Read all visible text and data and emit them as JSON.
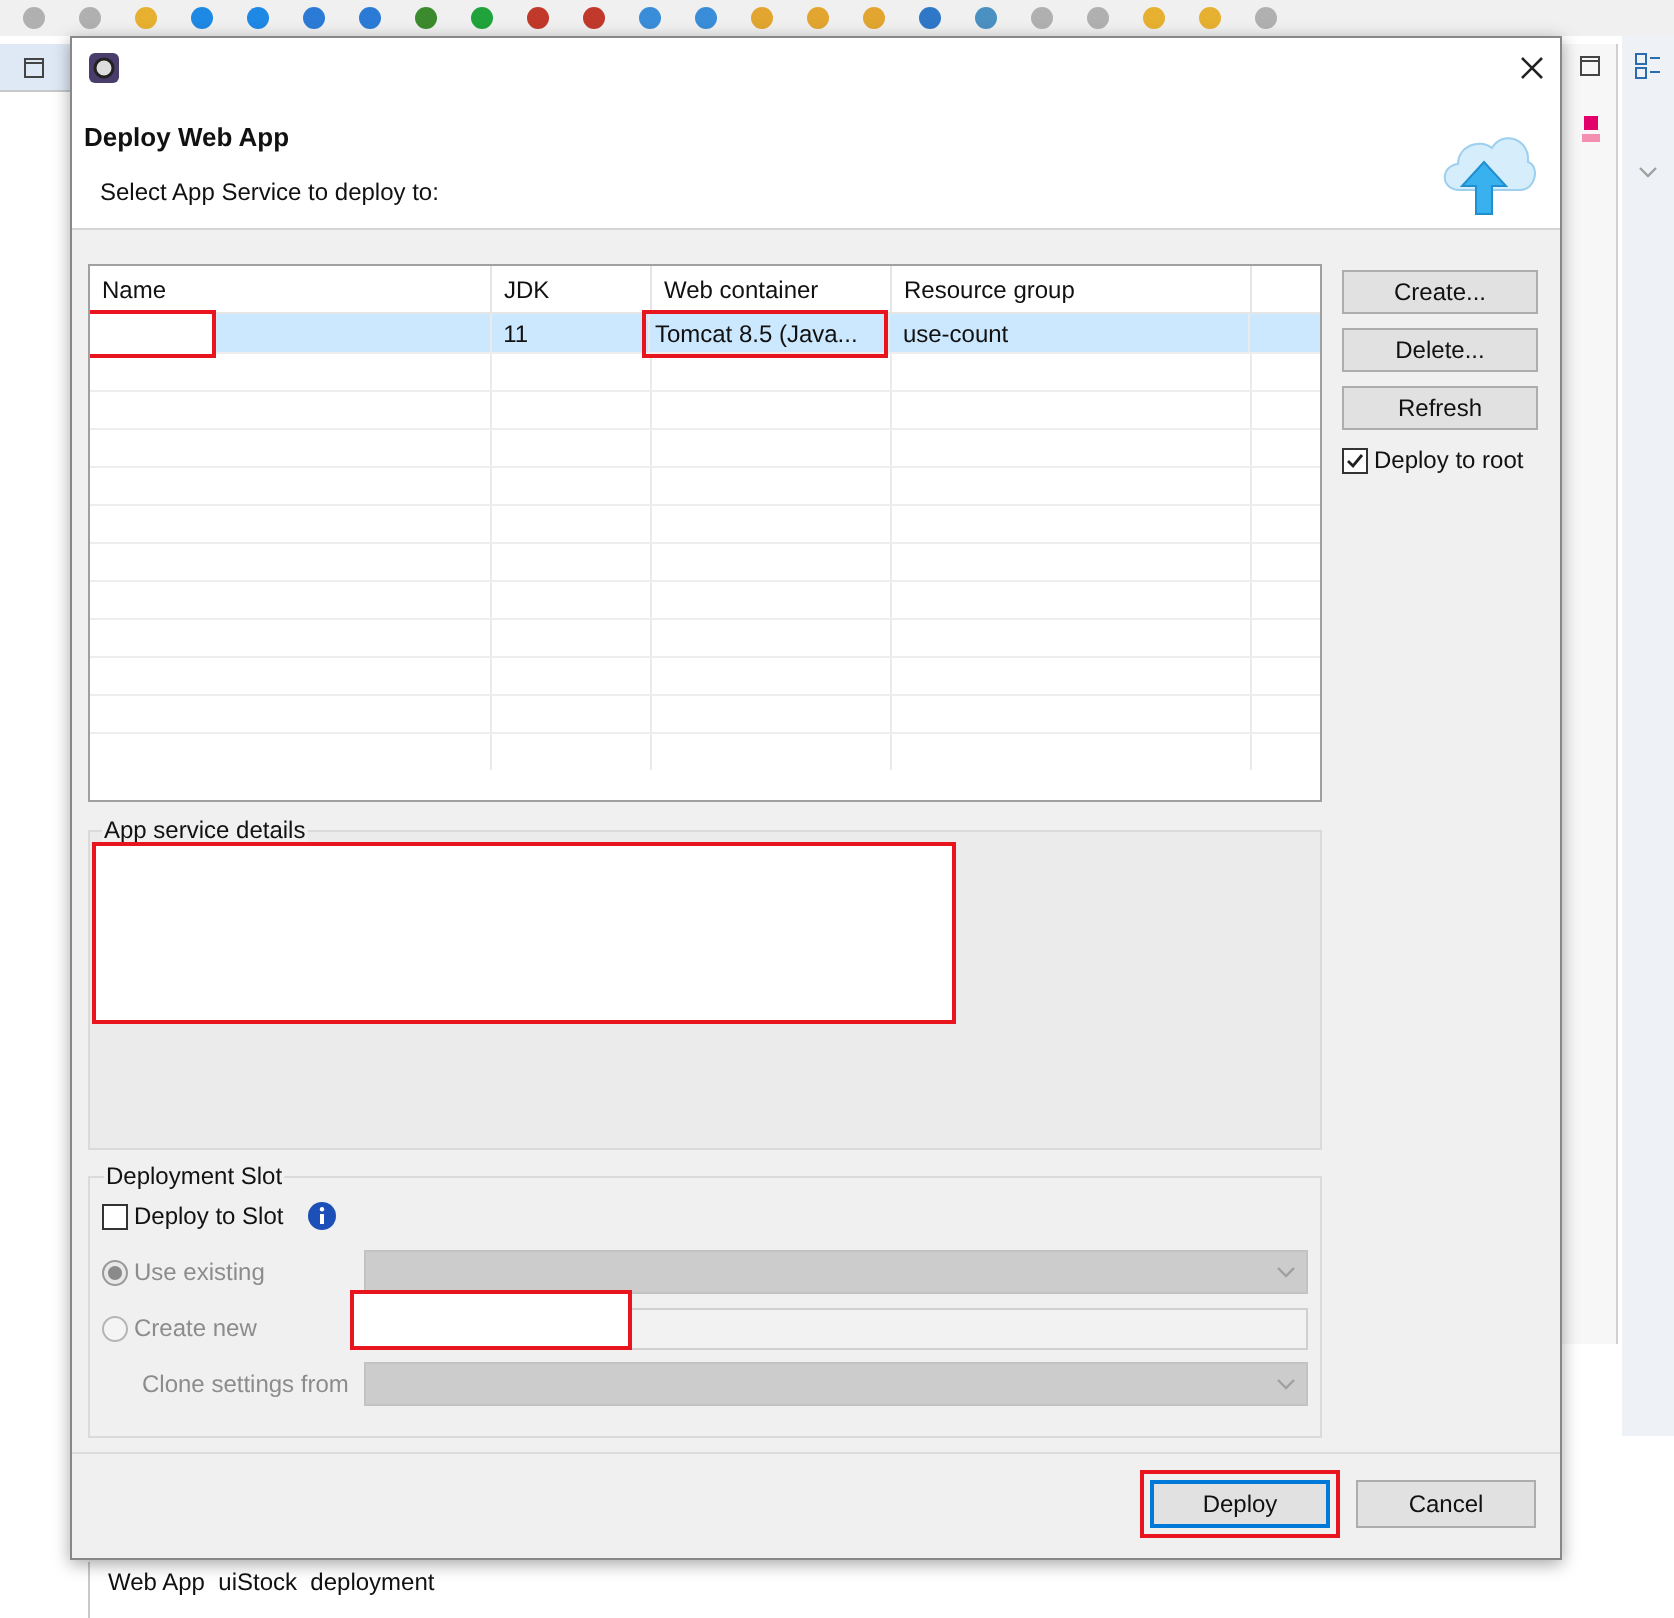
{
  "background_console": {
    "text": "Web App  uiStock  deployment"
  },
  "dialog": {
    "title": "Deploy Web App",
    "subtitle": "Select App Service to deploy to:"
  },
  "table": {
    "columns": [
      "Name",
      "JDK",
      "Web container",
      "Resource group"
    ],
    "rows": [
      {
        "selected": true,
        "cells": [
          {
            "text": "",
            "highlighted": true
          },
          {
            "text": "11",
            "highlighted": false
          },
          {
            "text": "Tomcat 8.5 (Java...",
            "highlighted": true
          },
          {
            "text": "use-count",
            "highlighted": false
          }
        ]
      }
    ]
  },
  "side_buttons": [
    "Create...",
    "Delete...",
    "Refresh"
  ],
  "deploy_to_root": {
    "label": "Deploy to root",
    "checked": true
  },
  "details": {
    "label": "App service details",
    "highlighted": true
  },
  "slot": {
    "label": "Deployment Slot",
    "deploy_to_slot": {
      "label": "Deploy to Slot",
      "checked": false
    },
    "options": [
      {
        "kind": "radio_dropdown",
        "label": "Use existing",
        "selected": true
      },
      {
        "kind": "radio_text",
        "label": "Create new",
        "selected": false,
        "highlighted": true
      },
      {
        "kind": "dropdown",
        "label": "Clone settings from"
      }
    ]
  },
  "footer_buttons": [
    {
      "label": "Deploy",
      "default": true,
      "highlighted": true
    },
    {
      "label": "Cancel",
      "default": false,
      "highlighted": false
    }
  ]
}
